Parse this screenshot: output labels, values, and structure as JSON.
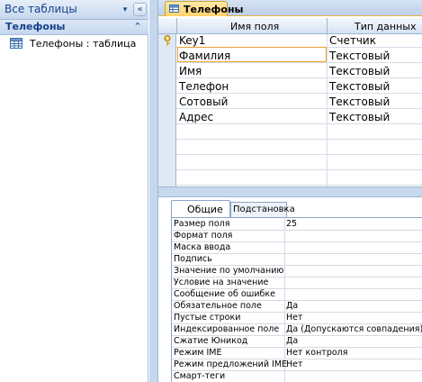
{
  "nav": {
    "title": "Все таблицы",
    "dropdown_glyph": "▾",
    "close_glyph": "«",
    "group": {
      "title": "Телефоны",
      "collapse_glyph": "⌃"
    },
    "items": [
      {
        "label": "Телефоны : таблица",
        "icon": "table-icon"
      }
    ]
  },
  "document_tab": {
    "label": "Телефоны",
    "icon": "table-icon"
  },
  "grid": {
    "columns": {
      "name": "Имя поля",
      "type": "Тип данных"
    },
    "rows": [
      {
        "name": "Key1",
        "type": "Счетчик",
        "primary_key": true
      },
      {
        "name": "Фамилия",
        "type": "Текстовый"
      },
      {
        "name": "Имя",
        "type": "Текстовый"
      },
      {
        "name": "Телефон",
        "type": "Текстовый"
      },
      {
        "name": "Сотовый",
        "type": "Текстовый"
      },
      {
        "name": "Адрес",
        "type": "Текстовый"
      }
    ]
  },
  "properties": {
    "tabs": {
      "general": "Общие",
      "lookup": "Подстановка"
    },
    "rows": [
      {
        "label": "Размер поля",
        "value": "25"
      },
      {
        "label": "Формат поля",
        "value": ""
      },
      {
        "label": "Маска ввода",
        "value": ""
      },
      {
        "label": "Подпись",
        "value": ""
      },
      {
        "label": "Значение по умолчанию",
        "value": ""
      },
      {
        "label": "Условие на значение",
        "value": ""
      },
      {
        "label": "Сообщение об ошибке",
        "value": ""
      },
      {
        "label": "Обязательное поле",
        "value": "Да"
      },
      {
        "label": "Пустые строки",
        "value": "Нет"
      },
      {
        "label": "Индексированное поле",
        "value": "Да (Допускаются совпадения)"
      },
      {
        "label": "Сжатие Юникод",
        "value": "Да"
      },
      {
        "label": "Режим IME",
        "value": "Нет контроля"
      },
      {
        "label": "Режим предложений IME",
        "value": "Нет"
      },
      {
        "label": "Смарт-теги",
        "value": ""
      }
    ]
  },
  "colors": {
    "accent": "#f0a030",
    "nav_text": "#15428b",
    "header_bg": "#c6d7ee"
  }
}
